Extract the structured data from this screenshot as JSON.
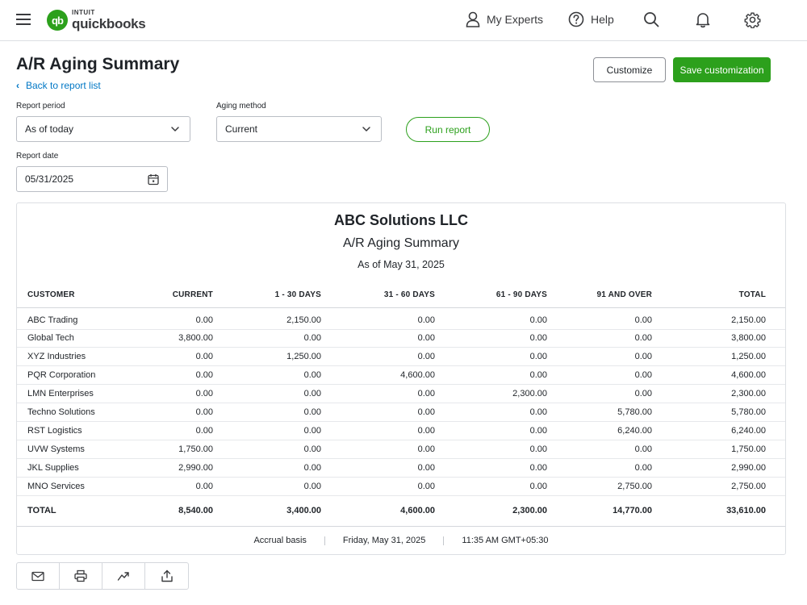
{
  "header": {
    "logo_brand": "INTUIT",
    "logo_product": "quickbooks",
    "logo_mark": "qb",
    "nav": [
      {
        "label": "My Experts",
        "icon": "person-icon"
      },
      {
        "label": "Help",
        "icon": "help-icon"
      }
    ],
    "icons": [
      "menu-icon",
      "search-icon",
      "bell-icon",
      "gear-icon"
    ]
  },
  "page": {
    "title": "A/R Aging Summary",
    "back_link": "Back to report list",
    "customize_label": "Customize",
    "save_label": "Save customization"
  },
  "filters": {
    "report_period_label": "Report period",
    "report_period_value": "As of today",
    "aging_method_label": "Aging method",
    "aging_method_value": "Current",
    "run_label": "Run report",
    "report_date_label": "Report date",
    "report_date_value": "05/31/2025"
  },
  "report": {
    "company": "ABC Solutions LLC",
    "title": "A/R Aging Summary",
    "as_of": "As of May 31, 2025",
    "columns": [
      "CUSTOMER",
      "CURRENT",
      "1 - 30 DAYS",
      "31 - 60 DAYS",
      "61 - 90 DAYS",
      "91 AND OVER",
      "TOTAL"
    ],
    "rows": [
      [
        "ABC Trading",
        "0.00",
        "2,150.00",
        "0.00",
        "0.00",
        "0.00",
        "2,150.00"
      ],
      [
        "Global Tech",
        "3,800.00",
        "0.00",
        "0.00",
        "0.00",
        "0.00",
        "3,800.00"
      ],
      [
        "XYZ Industries",
        "0.00",
        "1,250.00",
        "0.00",
        "0.00",
        "0.00",
        "1,250.00"
      ],
      [
        "PQR Corporation",
        "0.00",
        "0.00",
        "4,600.00",
        "0.00",
        "0.00",
        "4,600.00"
      ],
      [
        "LMN Enterprises",
        "0.00",
        "0.00",
        "0.00",
        "2,300.00",
        "0.00",
        "2,300.00"
      ],
      [
        "Techno Solutions",
        "0.00",
        "0.00",
        "0.00",
        "0.00",
        "5,780.00",
        "5,780.00"
      ],
      [
        "RST Logistics",
        "0.00",
        "0.00",
        "0.00",
        "0.00",
        "6,240.00",
        "6,240.00"
      ],
      [
        "UVW Systems",
        "1,750.00",
        "0.00",
        "0.00",
        "0.00",
        "0.00",
        "1,750.00"
      ],
      [
        "JKL Supplies",
        "2,990.00",
        "0.00",
        "0.00",
        "0.00",
        "0.00",
        "2,990.00"
      ],
      [
        "MNO Services",
        "0.00",
        "0.00",
        "0.00",
        "0.00",
        "2,750.00",
        "2,750.00"
      ]
    ],
    "total": [
      "TOTAL",
      "8,540.00",
      "3,400.00",
      "4,600.00",
      "2,300.00",
      "14,770.00",
      "33,610.00"
    ],
    "footer": {
      "basis": "Accrual basis",
      "date": "Friday, May 31, 2025",
      "time": "11:35 AM GMT+05:30"
    }
  },
  "toolbar": [
    "email-icon",
    "print-icon",
    "share-icon",
    "export-icon"
  ],
  "colors": {
    "brand_green": "#2ca01c",
    "link_blue": "#0077c5",
    "text": "#1f2328",
    "border": "#d4d7dc"
  }
}
